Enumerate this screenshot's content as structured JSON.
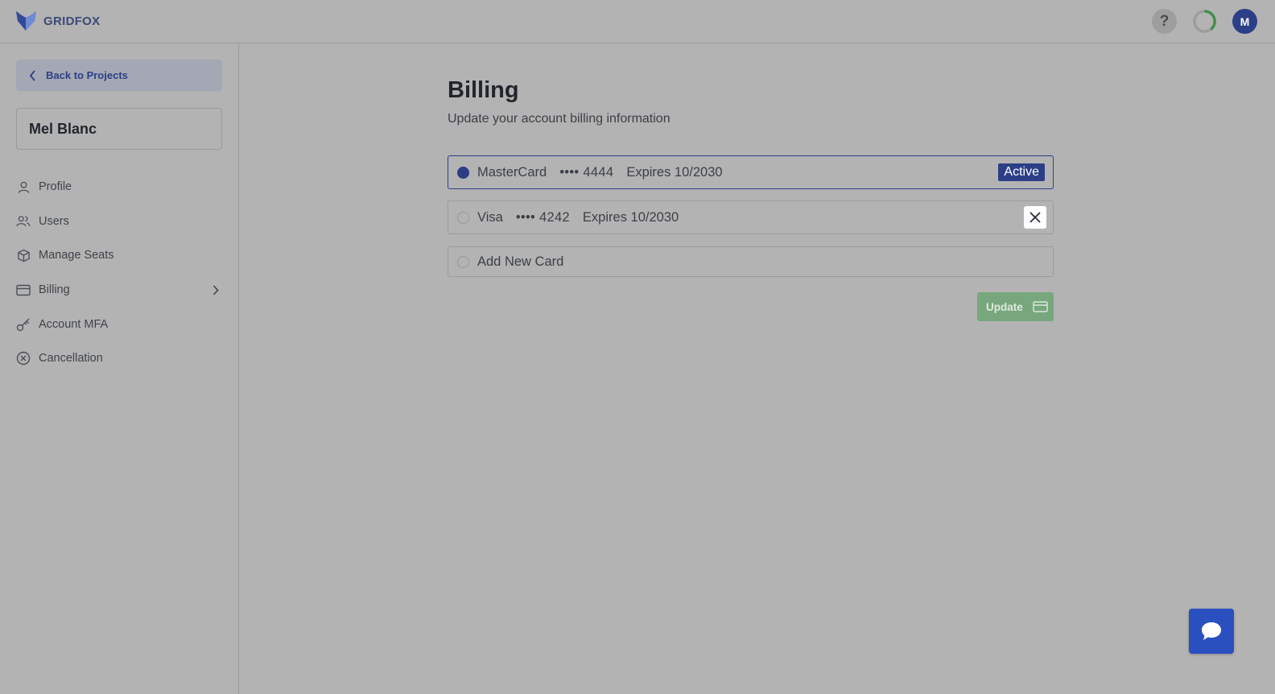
{
  "header": {
    "brand_name": "GRIDFOX",
    "help_label": "?",
    "avatar_initial": "M"
  },
  "sidebar": {
    "back_label": "Back to Projects",
    "user_name": "Mel Blanc",
    "items": [
      {
        "label": "Profile",
        "icon": "user-icon"
      },
      {
        "label": "Users",
        "icon": "users-icon"
      },
      {
        "label": "Manage Seats",
        "icon": "box-icon"
      },
      {
        "label": "Billing",
        "icon": "credit-card-icon"
      },
      {
        "label": "Account MFA",
        "icon": "key-icon"
      },
      {
        "label": "Cancellation",
        "icon": "x-circle-icon"
      }
    ]
  },
  "main": {
    "title": "Billing",
    "subtitle": "Update your account billing information",
    "cards": [
      {
        "brand": "MasterCard",
        "digits": "•••• 4444",
        "expires": "Expires 10/2030",
        "badge": "Active",
        "selected": true
      },
      {
        "brand": "Visa",
        "digits": "•••• 4242",
        "expires": "Expires 10/2030",
        "selected": false
      }
    ],
    "add_new_label": "Add New Card",
    "update_label": "Update"
  },
  "colors": {
    "accent": "#2c3f86",
    "update_button": "#78a77e",
    "chat_button": "#2a4fbf"
  }
}
